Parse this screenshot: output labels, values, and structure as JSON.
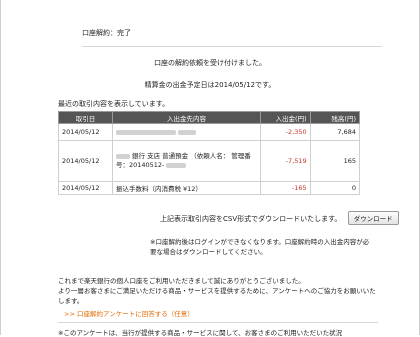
{
  "page": {
    "title": "口座解約：完了",
    "message_accepted": "口座の解約依頼を受け付けました。",
    "message_date": "精算金の出金予定日は2014/05/12です。",
    "intro": "最近の取引内容を表示しています。"
  },
  "table": {
    "headers": [
      "取引日",
      "入出金先内容",
      "入出金(円)",
      "残高(円)"
    ],
    "rows": [
      {
        "date": "2014/05/12",
        "desc_text": "",
        "amount": "-2,350",
        "balance": "7,684"
      },
      {
        "date": "2014/05/12",
        "desc_text": "銀行 支店 普通預金 （依頼人名： 管理番号：20140512-",
        "amount": "-7,519",
        "balance": "165"
      },
      {
        "date": "2014/05/12",
        "desc_text": "振込手数料（内消費税 ¥12）",
        "amount": "-165",
        "balance": "0"
      }
    ]
  },
  "csv": {
    "text": "上記表示取引内容をCSV形式でダウンロードいたします。",
    "button_label": "ダウンロード"
  },
  "note": {
    "text": "※口座解約後はログインができなくなります。口座解約時の入出金内容が必要な場合はダウンロードしてください。"
  },
  "thanks": {
    "line1": "これまで楽天銀行の個人口座をご利用いただきまして誠にありがとうございました。",
    "line2": "より一層お客さまにご満足いただける商品・サービスを提供するために、アンケートへのご協力をお願いいたします。"
  },
  "survey": {
    "link_label": ">> 口座解約アンケートに回答する（任意）"
  },
  "footer": {
    "text": "※このアンケートは、当行が提供する商品・サービスに関して、お客さまのご利用いただいた状況"
  },
  "colors": {
    "negative": "#c0392b",
    "link": "#e36a00",
    "header_bg": "#555555"
  }
}
